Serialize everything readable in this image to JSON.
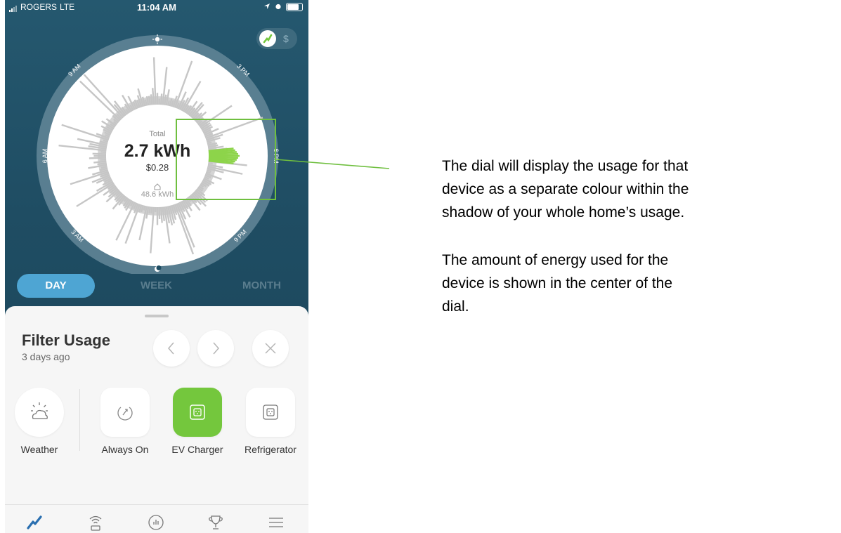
{
  "status_bar": {
    "carrier": "ROGERS",
    "network": "LTE",
    "time": "11:04 AM"
  },
  "toggle": {
    "dollar_label": "$"
  },
  "dial": {
    "total_label": "Total",
    "total_kwh": "2.7 kWh",
    "cost": "$0.28",
    "home_kwh": "48.6 kWh",
    "hour_labels": {
      "h6am": "6 AM",
      "h9am": "9 AM",
      "h3pm": "3 PM",
      "h6pm": "6 PM",
      "h9pm": "9 PM",
      "h3am": "3 AM"
    },
    "accent_color": "#8dd44a"
  },
  "tabs": {
    "day": "DAY",
    "week": "WEEK",
    "month": "MONTH"
  },
  "filter": {
    "title": "Filter Usage",
    "subtitle": "3 days ago"
  },
  "devices": {
    "weather": "Weather",
    "always_on": "Always On",
    "ev_charger": "EV Charger",
    "refrigerator": "Refrigerator"
  },
  "annotations": {
    "dial_description": "The dial will display the usage for that device as a separate colour within the shadow of your whole home’s usage.",
    "center_description": "The amount of energy used for the device is shown in the center of the dial."
  }
}
